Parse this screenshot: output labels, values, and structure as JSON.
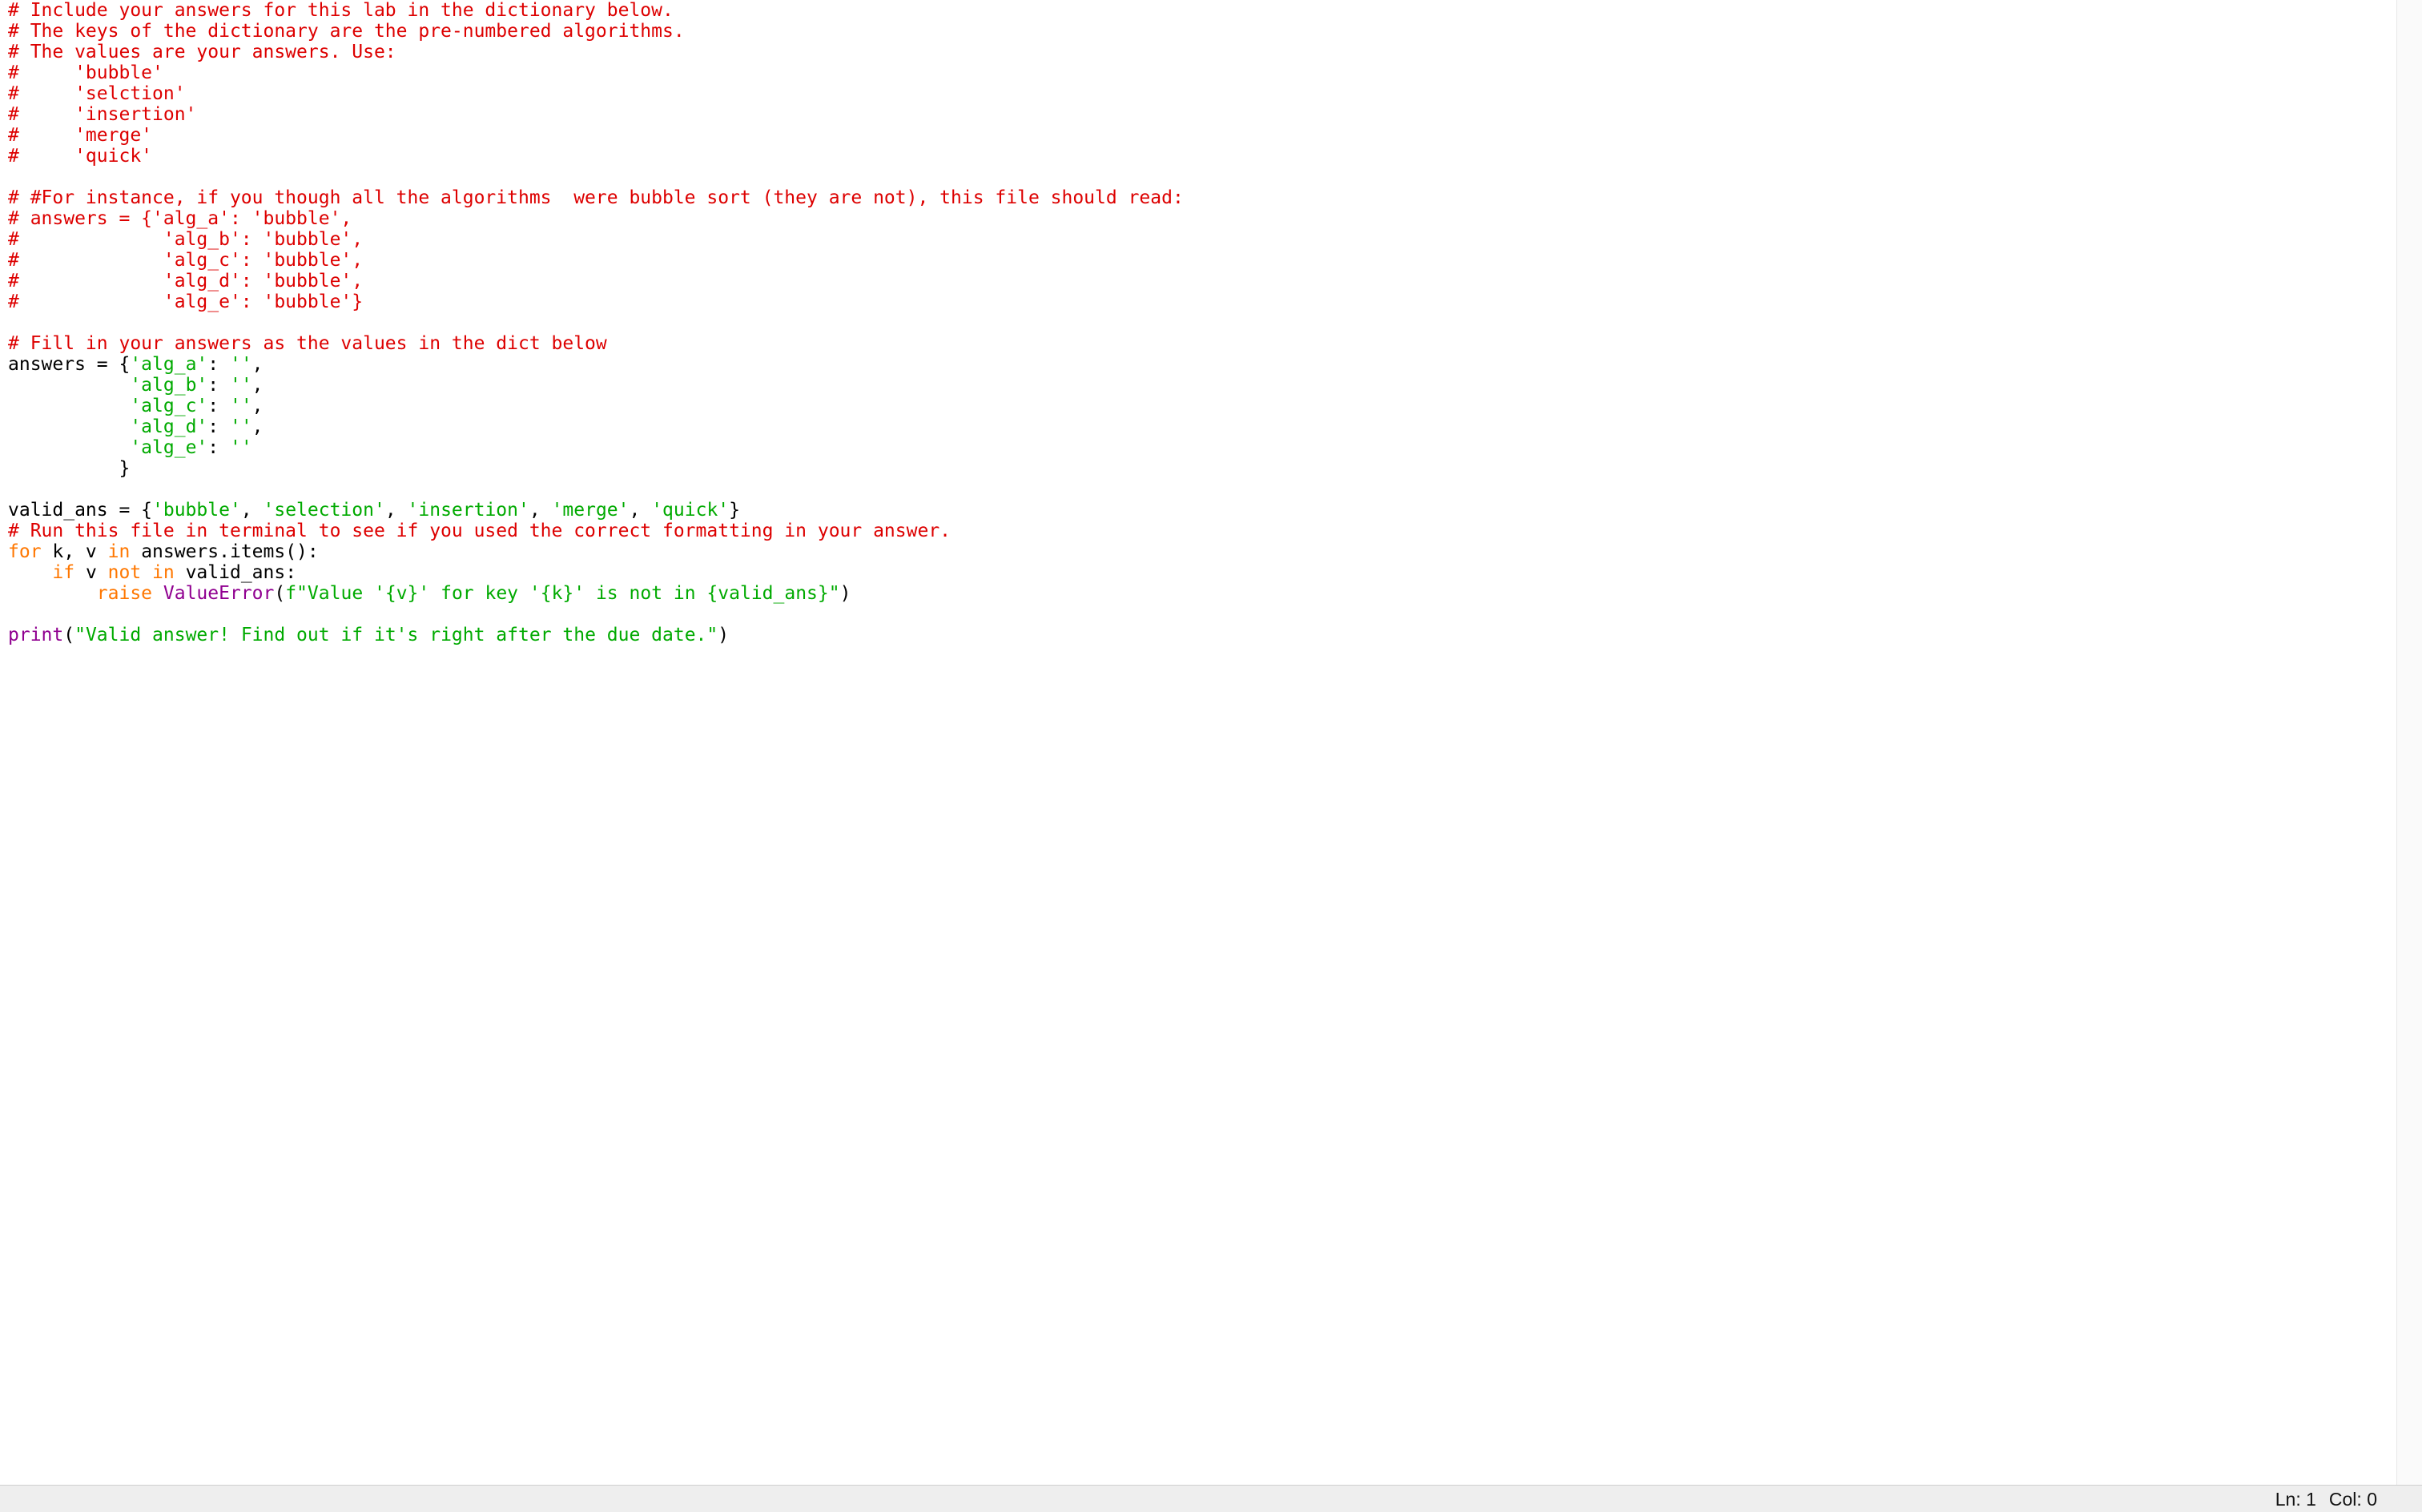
{
  "editor": {
    "lines": [
      [
        {
          "t": "# Include your answers for this lab in the dictionary below.",
          "c": "comment"
        }
      ],
      [
        {
          "t": "# The keys of the dictionary are the pre-numbered algorithms.",
          "c": "comment"
        }
      ],
      [
        {
          "t": "# The values are your answers. Use:",
          "c": "comment"
        }
      ],
      [
        {
          "t": "#     'bubble'",
          "c": "comment"
        }
      ],
      [
        {
          "t": "#     'selction'",
          "c": "comment"
        }
      ],
      [
        {
          "t": "#     'insertion'",
          "c": "comment"
        }
      ],
      [
        {
          "t": "#     'merge'",
          "c": "comment"
        }
      ],
      [
        {
          "t": "#     'quick'",
          "c": "comment"
        }
      ],
      [],
      [
        {
          "t": "# #For instance, if you though all the algorithms  were bubble sort (they are not), this file should read:",
          "c": "comment"
        }
      ],
      [
        {
          "t": "# answers = {'alg_a': 'bubble',",
          "c": "comment"
        }
      ],
      [
        {
          "t": "#             'alg_b': 'bubble',",
          "c": "comment"
        }
      ],
      [
        {
          "t": "#             'alg_c': 'bubble',",
          "c": "comment"
        }
      ],
      [
        {
          "t": "#             'alg_d': 'bubble',",
          "c": "comment"
        }
      ],
      [
        {
          "t": "#             'alg_e': 'bubble'}",
          "c": "comment"
        }
      ],
      [],
      [
        {
          "t": "# Fill in your answers as the values in the dict below",
          "c": "comment"
        }
      ],
      [
        {
          "t": "answers = {",
          "c": "default"
        },
        {
          "t": "'alg_a'",
          "c": "string"
        },
        {
          "t": ": ",
          "c": "default"
        },
        {
          "t": "''",
          "c": "string"
        },
        {
          "t": ",",
          "c": "default"
        }
      ],
      [
        {
          "t": "           ",
          "c": "default"
        },
        {
          "t": "'alg_b'",
          "c": "string"
        },
        {
          "t": ": ",
          "c": "default"
        },
        {
          "t": "''",
          "c": "string"
        },
        {
          "t": ",",
          "c": "default"
        }
      ],
      [
        {
          "t": "           ",
          "c": "default"
        },
        {
          "t": "'alg_c'",
          "c": "string"
        },
        {
          "t": ": ",
          "c": "default"
        },
        {
          "t": "''",
          "c": "string"
        },
        {
          "t": ",",
          "c": "default"
        }
      ],
      [
        {
          "t": "           ",
          "c": "default"
        },
        {
          "t": "'alg_d'",
          "c": "string"
        },
        {
          "t": ": ",
          "c": "default"
        },
        {
          "t": "''",
          "c": "string"
        },
        {
          "t": ",",
          "c": "default"
        }
      ],
      [
        {
          "t": "           ",
          "c": "default"
        },
        {
          "t": "'alg_e'",
          "c": "string"
        },
        {
          "t": ": ",
          "c": "default"
        },
        {
          "t": "''",
          "c": "string"
        }
      ],
      [
        {
          "t": "          }",
          "c": "default"
        }
      ],
      [],
      [
        {
          "t": "valid_ans = {",
          "c": "default"
        },
        {
          "t": "'bubble'",
          "c": "string"
        },
        {
          "t": ", ",
          "c": "default"
        },
        {
          "t": "'selection'",
          "c": "string"
        },
        {
          "t": ", ",
          "c": "default"
        },
        {
          "t": "'insertion'",
          "c": "string"
        },
        {
          "t": ", ",
          "c": "default"
        },
        {
          "t": "'merge'",
          "c": "string"
        },
        {
          "t": ", ",
          "c": "default"
        },
        {
          "t": "'quick'",
          "c": "string"
        },
        {
          "t": "}",
          "c": "default"
        }
      ],
      [
        {
          "t": "# Run this file in terminal to see if you used the correct formatting in your answer.",
          "c": "comment"
        }
      ],
      [
        {
          "t": "for",
          "c": "keyword"
        },
        {
          "t": " k, v ",
          "c": "default"
        },
        {
          "t": "in",
          "c": "keyword"
        },
        {
          "t": " answers.items():",
          "c": "default"
        }
      ],
      [
        {
          "t": "    ",
          "c": "default"
        },
        {
          "t": "if",
          "c": "keyword"
        },
        {
          "t": " v ",
          "c": "default"
        },
        {
          "t": "not in",
          "c": "keyword"
        },
        {
          "t": " valid_ans:",
          "c": "default"
        }
      ],
      [
        {
          "t": "        ",
          "c": "default"
        },
        {
          "t": "raise",
          "c": "keyword"
        },
        {
          "t": " ",
          "c": "default"
        },
        {
          "t": "ValueError",
          "c": "builtin"
        },
        {
          "t": "(",
          "c": "default"
        },
        {
          "t": "f\"Value '{v}' for key '{k}' is not in {valid_ans}\"",
          "c": "string"
        },
        {
          "t": ")",
          "c": "default"
        }
      ],
      [],
      [
        {
          "t": "print",
          "c": "builtin"
        },
        {
          "t": "(",
          "c": "default"
        },
        {
          "t": "\"Valid answer! Find out if it's right after the due date.\"",
          "c": "string"
        },
        {
          "t": ")",
          "c": "default"
        }
      ]
    ]
  },
  "statusbar": {
    "line": "Ln: 1",
    "col": "Col: 0"
  }
}
